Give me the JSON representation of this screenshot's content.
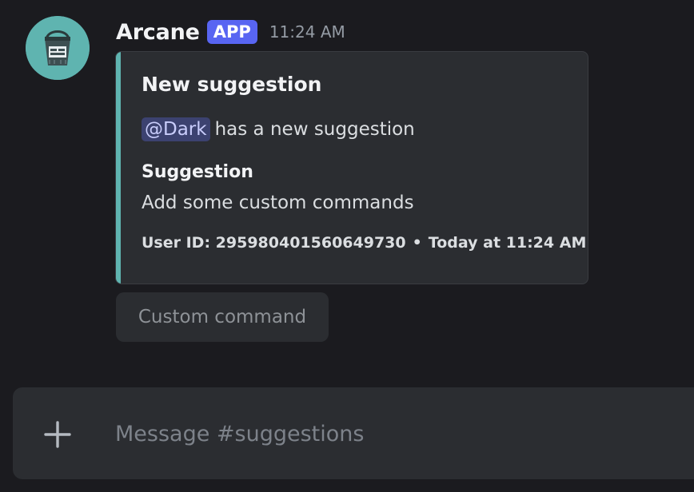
{
  "message": {
    "avatar_icon": "paint-bucket-icon",
    "author": "Arcane",
    "badge": "APP",
    "timestamp": "11:24 AM"
  },
  "embed": {
    "accent_color": "#5fb4b0",
    "title": "New suggestion",
    "mention": "@Dark",
    "description_rest": "has a new suggestion",
    "field_name": "Suggestion",
    "field_value": "Add some custom commands",
    "footer_user_id": "User ID: 295980401560649730",
    "footer_separator": "•",
    "footer_time": "Today at 11:24 AM"
  },
  "action": {
    "button_label": "Custom command"
  },
  "composer": {
    "placeholder": "Message #suggestions",
    "plus_icon": "plus-icon"
  },
  "colors": {
    "background": "#1b1b1f",
    "badge": "#5865f2",
    "mention_bg": "#3c4270"
  }
}
